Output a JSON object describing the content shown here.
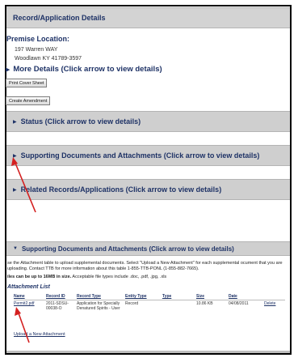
{
  "header": {
    "title": "Record/Application Details"
  },
  "premise": {
    "label": "Premise Location:",
    "address_line1": "197 Warren WAY",
    "address_line2": "Woodlawn KY 41789-3597"
  },
  "more_details_label": "More Details (Click arrow to view details)",
  "buttons": {
    "print_cover_sheet": "Print Cover Sheet",
    "create_amendment": "Create Amendment"
  },
  "sections": {
    "status": "Status (Click arrow to view details)",
    "supporting_docs": "Supporting Documents and Attachments (Click arrow to view details)",
    "related_records": "Related Records/Applications (Click arrow to view details)",
    "supporting_docs_expanded": "Supporting Documents and Attachments (Click arrow to view details)"
  },
  "attachments": {
    "instruction": "se the Attachment table to upload supplemental documents.  Select \"Upload a New Attachment\" for each supplemental ocument that you are uploading.  Contact TTB for more information about this table 1-855-TTB-PONL (1-855-882-7665).",
    "size_note_bold": "iles can be up to 16MB in size.",
    "size_note_rest": "  Acceptable file types include .doc, .pdf, .jpg, .xls",
    "list_heading": "Attachment List",
    "columns": [
      "Name",
      "Record ID",
      "Record Type",
      "Entity Type",
      "Type",
      "Size",
      "Date",
      ""
    ],
    "rows": [
      {
        "name": "Permit2.pdf",
        "record_id": "2011-SDSU-00038-O",
        "record_type": "Application for Specially Denatured Spirits - User",
        "entity_type": "Record",
        "type": "",
        "size": "10.86 KB",
        "date": "04/08/2011",
        "action": "Delete"
      }
    ],
    "upload_link": "Upload a New Attachment"
  },
  "colors": {
    "band_gray": "#cfcfcf",
    "text_navy": "#1e3266",
    "annotation_red": "#d42020"
  },
  "icons": [
    "expand-triangle-icon",
    "collapse-triangle-icon",
    "red-annotation-arrow"
  ]
}
